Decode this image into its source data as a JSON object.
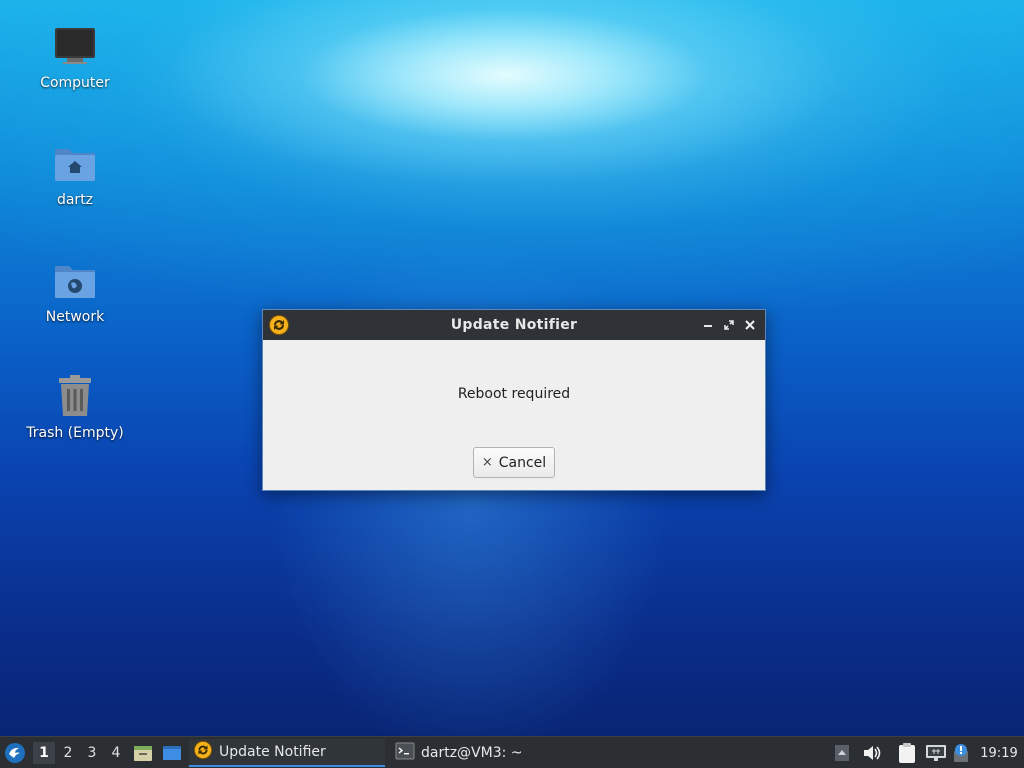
{
  "desktop": {
    "icons": [
      {
        "label": "Computer"
      },
      {
        "label": "dartz"
      },
      {
        "label": "Network"
      },
      {
        "label": "Trash (Empty)"
      }
    ]
  },
  "dialog": {
    "title": "Update Notifier",
    "message": "Reboot required",
    "cancel_label": "Cancel",
    "cancel_icon": "×"
  },
  "taskbar": {
    "workspaces": [
      "1",
      "2",
      "3",
      "4"
    ],
    "tasks": [
      {
        "label": "Update Notifier"
      },
      {
        "label": "dartz@VM3: ~"
      }
    ],
    "clock": "19:19"
  },
  "colors": {
    "titlebar": "#2f3338",
    "taskbar": "#2b2f33",
    "accent": "#3c8ee0"
  }
}
